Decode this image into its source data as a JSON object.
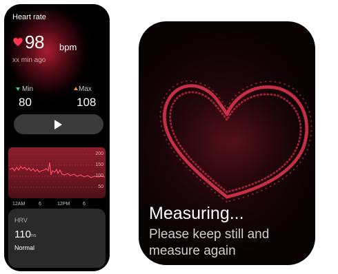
{
  "left_watch": {
    "title": "Heart rate",
    "bpm_value": "98",
    "bpm_unit": "bpm",
    "time_ago": "xx min ago",
    "min_label": "Min",
    "min_value": "80",
    "max_label": "Max",
    "max_value": "108",
    "play_button_icon": "play-icon",
    "chart": {
      "y_ticks": [
        "200",
        "150",
        "100",
        "50"
      ],
      "x_ticks": [
        "12AM",
        "6",
        "12PM",
        "6"
      ]
    },
    "hrv": {
      "label": "HRV",
      "value": "110",
      "unit": "ms",
      "status": "Normal"
    }
  },
  "right_watch": {
    "heading": "Measuring...",
    "instruction": "Please keep still and measure again"
  },
  "colors": {
    "accent_red": "#e8324a",
    "min_green": "#40c97a",
    "max_orange": "#ff8a3c"
  }
}
